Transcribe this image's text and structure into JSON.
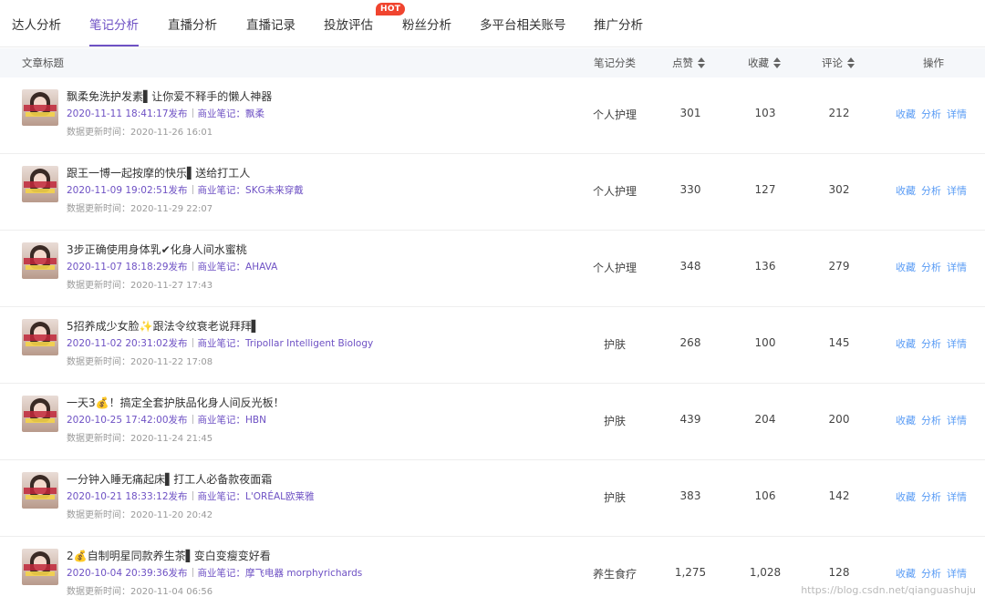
{
  "tabs": [
    {
      "label": "达人分析"
    },
    {
      "label": "笔记分析"
    },
    {
      "label": "直播分析"
    },
    {
      "label": "直播记录"
    },
    {
      "label": "投放评估"
    },
    {
      "label": "粉丝分析"
    },
    {
      "label": "多平台相关账号"
    },
    {
      "label": "推广分析"
    }
  ],
  "hot_badge": "HOT",
  "table": {
    "headers": {
      "title": "文章标题",
      "category": "笔记分类",
      "likes": "点赞",
      "favorites": "收藏",
      "comments": "评论",
      "actions": "操作"
    },
    "action_labels": {
      "fav": "收藏",
      "analyze": "分析",
      "detail": "详情"
    },
    "rows": [
      {
        "title": "飘柔免洗护发素▌让你爱不释手的懒人神器",
        "publish": "2020-11-11 18:41:17发布",
        "brand": "商业笔记：飘柔",
        "updated": "数据更新时间：2020-11-26 16:01",
        "category": "个人护理",
        "likes": "301",
        "favorites": "103",
        "comments": "212"
      },
      {
        "title": "跟王一博一起按摩的快乐▌送给打工人",
        "publish": "2020-11-09 19:02:51发布",
        "brand": "商业笔记：SKG未来穿戴",
        "updated": "数据更新时间：2020-11-29 22:07",
        "category": "个人护理",
        "likes": "330",
        "favorites": "127",
        "comments": "302"
      },
      {
        "title": "3步正确使用身体乳✔化身人间水蜜桃",
        "publish": "2020-11-07 18:18:29发布",
        "brand": "商业笔记：AHAVA",
        "updated": "数据更新时间：2020-11-27 17:43",
        "category": "个人护理",
        "likes": "348",
        "favorites": "136",
        "comments": "279"
      },
      {
        "title": "5招养成少女脸✨跟法令纹衰老说拜拜▌",
        "publish": "2020-11-02 20:31:02发布",
        "brand": "商业笔记：Tripollar Intelligent Biology",
        "updated": "数据更新时间：2020-11-22 17:08",
        "category": "护肤",
        "likes": "268",
        "favorites": "100",
        "comments": "145"
      },
      {
        "title": "一天3💰！搞定全套护肤品化身人间反光板！",
        "publish": "2020-10-25 17:42:00发布",
        "brand": "商业笔记：HBN",
        "updated": "数据更新时间：2020-11-24 21:45",
        "category": "护肤",
        "likes": "439",
        "favorites": "204",
        "comments": "200"
      },
      {
        "title": "一分钟入睡无痛起床▌打工人必备款夜面霜",
        "publish": "2020-10-21 18:33:12发布",
        "brand": "商业笔记：L'ORÉAL欧莱雅",
        "updated": "数据更新时间：2020-11-20 20:42",
        "category": "护肤",
        "likes": "383",
        "favorites": "106",
        "comments": "142"
      },
      {
        "title": "2💰自制明星同款养生茶▌变白变瘦变好看",
        "publish": "2020-10-04 20:39:36发布",
        "brand": "商业笔记：摩飞电器 morphyrichards",
        "updated": "数据更新时间：2020-11-04 06:56",
        "category": "养生食疗",
        "likes": "1,275",
        "favorites": "1,028",
        "comments": "128"
      }
    ]
  },
  "watermark": "https://blog.csdn.net/qianguashuju",
  "colors": {
    "accent": "#6e51c4",
    "link": "#5a9cf5",
    "hot": "#f0442f",
    "header_bg": "#f5f7fa"
  }
}
